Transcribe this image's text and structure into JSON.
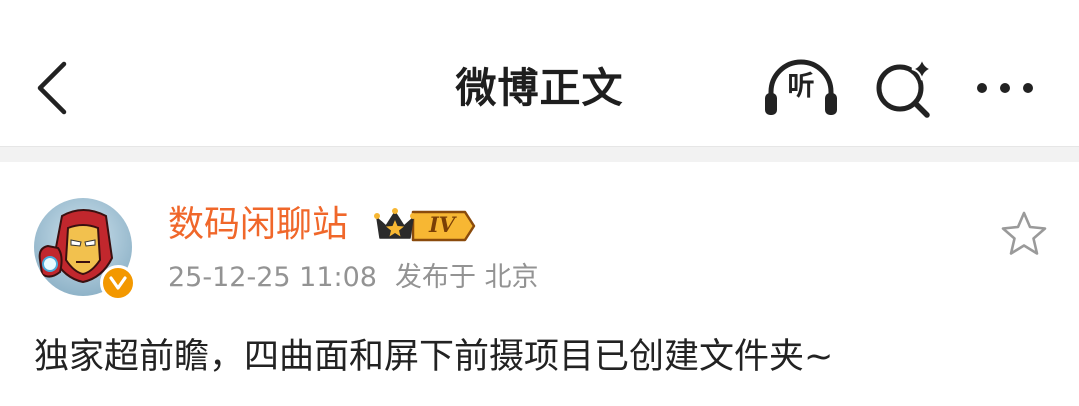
{
  "nav": {
    "title": "微博正文",
    "listen_label": "听",
    "back_icon": "chevron-left-icon",
    "search_icon": "sparkle-search-icon",
    "more_icon": "ellipsis-icon"
  },
  "post": {
    "author": {
      "name": "数码闲聊站",
      "vip_level": "IV",
      "verified_mark": "V",
      "avatar_icon": "iron-man-avatar"
    },
    "timestamp": "25-12-25 11:08",
    "location": "发布于 北京",
    "text": "独家超前瞻，四曲面和屏下前摄项目已创建文件夹~",
    "favorite_icon": "star-outline-icon"
  },
  "colors": {
    "author_name": "#f0672a",
    "verified_badge": "#f39800",
    "meta_text": "#939393",
    "divider": "#f2f2f2"
  }
}
